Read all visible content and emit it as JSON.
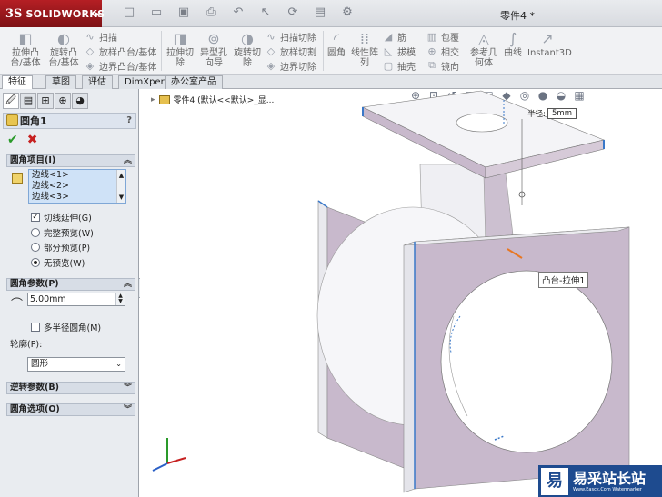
{
  "app": {
    "brand_ds": "3S",
    "brand_name": "SOLIDWORKS",
    "doc_title": "零件4 *"
  },
  "ribbon": {
    "big": [
      {
        "l1": "拉伸凸",
        "l2": "台/基体"
      },
      {
        "l1": "旋转凸",
        "l2": "台/基体"
      },
      {
        "l1": "拉伸切",
        "l2": "除"
      },
      {
        "l1": "异型孔",
        "l2": "向导"
      },
      {
        "l1": "旋转切",
        "l2": "除"
      },
      {
        "l1": "圆角",
        "l2": ""
      },
      {
        "l1": "线性阵",
        "l2": "列"
      },
      {
        "l1": "参考几",
        "l2": "何体"
      },
      {
        "l1": "曲线",
        "l2": ""
      },
      {
        "l1": "Instant3D",
        "l2": ""
      }
    ],
    "small": [
      "扫描",
      "放样凸台/基体",
      "边界凸台/基体",
      "扫描切除",
      "放样切割",
      "边界切除",
      "筋",
      "拔模",
      "抽壳",
      "包覆",
      "相交",
      "镜向"
    ]
  },
  "tabs": [
    "特征",
    "草图",
    "评估",
    "DimXpert",
    "办公室产品"
  ],
  "panel": {
    "title": "圆角1",
    "help": "?",
    "sec_items": "圆角项目(I)",
    "edges": [
      "边线<1>",
      "边线<2>",
      "边线<3>"
    ],
    "tangent": "切线延伸(G)",
    "radio": [
      "完整预览(W)",
      "部分预览(P)",
      "无预览(W)"
    ],
    "sec_params": "圆角参数(P)",
    "radius": "5.00mm",
    "multi": "多半径圆角(M)",
    "profile_label": "轮廓(P):",
    "profile_value": "圆形",
    "sec_reverse": "逆转参数(B)",
    "sec_options": "圆角选项(O)"
  },
  "viewport": {
    "tree": "零件4  (默认<<默认>_显...",
    "tooltip": "凸台-拉伸1",
    "radius_label": "半径:",
    "radius_value": "5mm"
  },
  "watermark": {
    "logo": "易",
    "name": "易采站长站",
    "url": "Www.Easck.Com Watermarker"
  },
  "colors": {
    "model_face": "#c8b9cc",
    "model_light": "#f2f2f5",
    "edge_select": "#3a78c8",
    "accent_orange": "#e87722"
  }
}
